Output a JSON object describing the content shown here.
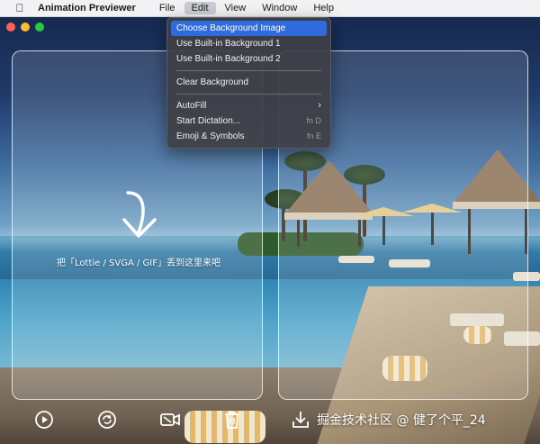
{
  "menubar": {
    "app_name": "Animation Previewer",
    "menus": [
      "File",
      "Edit",
      "View",
      "Window",
      "Help"
    ],
    "active_menu": "Edit"
  },
  "edit_menu": {
    "items": [
      {
        "label": "Choose Background Image",
        "highlighted": true
      },
      {
        "label": "Use Built-in Background 1"
      },
      {
        "label": "Use Built-in Background 2"
      },
      {
        "label": "Clear Background"
      },
      {
        "label": "AutoFill",
        "submenu": true
      },
      {
        "label": "Start Dictation...",
        "shortcut": "fn D"
      },
      {
        "label": "Emoji & Symbols",
        "shortcut": "fn E"
      }
    ]
  },
  "drop_zone": {
    "hint": "把「Lottie / SVGA / GIF」丢到这里来吧",
    "arrow_icon": "arrow-down-curve-icon"
  },
  "toolbar": {
    "icons": [
      "play-icon",
      "replay-icon",
      "video-icon",
      "trash-icon",
      "download-icon"
    ]
  },
  "watermark": "掘金技术社区 @ 健了个平_24",
  "colors": {
    "highlight": "#2f6bdc",
    "close": "#ff5f57",
    "minimize": "#febc2e",
    "zoom": "#28c840"
  }
}
